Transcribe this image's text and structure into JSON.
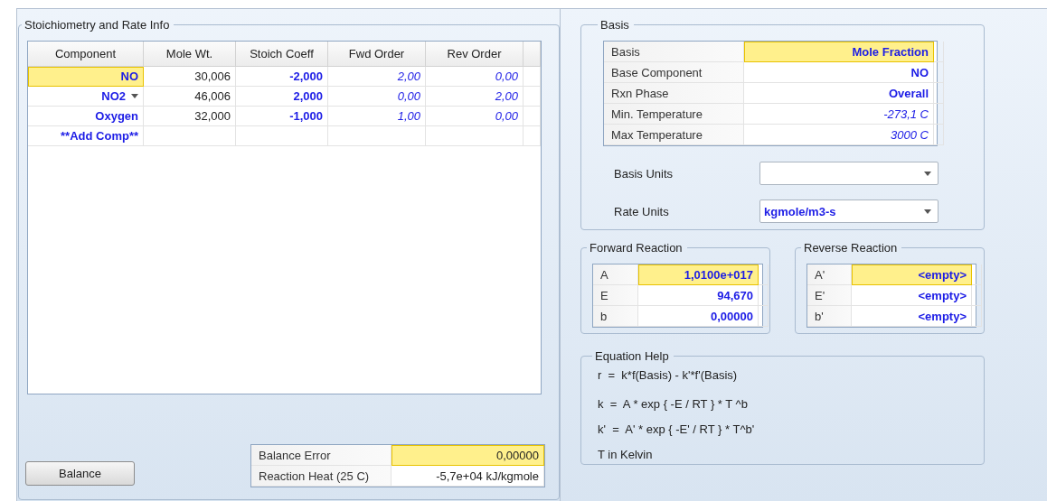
{
  "stoichiometry": {
    "title": "Stoichiometry and Rate Info",
    "columns": [
      "Component",
      "Mole Wt.",
      "Stoich Coeff",
      "Fwd Order",
      "Rev Order"
    ],
    "rows": [
      {
        "cells": [
          {
            "text": "NO",
            "kind": "specified",
            "selected": true
          },
          {
            "text": "30,006",
            "kind": "calculated",
            "selected": false
          },
          {
            "text": "-2,000",
            "kind": "specified",
            "selected": false
          },
          {
            "text": "2,00",
            "kind": "default",
            "selected": false
          },
          {
            "text": "0,00",
            "kind": "default",
            "selected": false
          }
        ]
      },
      {
        "cells": [
          {
            "text": "NO2",
            "kind": "specified",
            "selected": false,
            "dropdown": true
          },
          {
            "text": "46,006",
            "kind": "calculated",
            "selected": false
          },
          {
            "text": "2,000",
            "kind": "specified",
            "selected": false
          },
          {
            "text": "0,00",
            "kind": "default",
            "selected": false
          },
          {
            "text": "2,00",
            "kind": "default",
            "selected": false
          }
        ]
      },
      {
        "cells": [
          {
            "text": "Oxygen",
            "kind": "specified",
            "selected": false
          },
          {
            "text": "32,000",
            "kind": "calculated",
            "selected": false
          },
          {
            "text": "-1,000",
            "kind": "specified",
            "selected": false
          },
          {
            "text": "1,00",
            "kind": "default",
            "selected": false
          },
          {
            "text": "0,00",
            "kind": "default",
            "selected": false
          }
        ]
      },
      {
        "cells": [
          {
            "text": "**Add Comp**",
            "kind": "specified",
            "selected": false
          }
        ]
      }
    ]
  },
  "balance_button": "Balance",
  "balance": {
    "rows": [
      {
        "cells": [
          {
            "text": "Balance Error",
            "kind": "label"
          },
          {
            "text": "0,00000",
            "kind": "calculated",
            "selected": true
          }
        ]
      },
      {
        "cells": [
          {
            "text": "Reaction Heat (25 C)",
            "kind": "label"
          },
          {
            "text": "-5,7e+04 kJ/kgmole",
            "kind": "calculated",
            "selected": false
          }
        ]
      }
    ]
  },
  "basis": {
    "title": "Basis",
    "rows": [
      {
        "cells": [
          {
            "text": "Basis",
            "kind": "label"
          },
          {
            "text": "Mole Fraction",
            "kind": "specified",
            "selected": true
          }
        ]
      },
      {
        "cells": [
          {
            "text": "Base Component",
            "kind": "label"
          },
          {
            "text": "NO",
            "kind": "specified",
            "selected": false
          }
        ]
      },
      {
        "cells": [
          {
            "text": "Rxn Phase",
            "kind": "label"
          },
          {
            "text": "Overall",
            "kind": "specified",
            "selected": false
          }
        ]
      },
      {
        "cells": [
          {
            "text": "Min. Temperature",
            "kind": "label"
          },
          {
            "text": "-273,1 C",
            "kind": "default",
            "selected": false
          }
        ]
      },
      {
        "cells": [
          {
            "text": "Max Temperature",
            "kind": "label"
          },
          {
            "text": "3000 C",
            "kind": "default",
            "selected": false
          }
        ]
      }
    ],
    "fields": [
      {
        "label": "Basis Units"
      },
      {
        "label": "Rate Units",
        "value": "kgmole/m3-s"
      }
    ]
  },
  "forward_reaction": {
    "title": "Forward Reaction",
    "rows": [
      {
        "cells": [
          {
            "text": "A",
            "kind": "label"
          },
          {
            "text": "1,0100e+017",
            "kind": "specified",
            "selected": true
          }
        ]
      },
      {
        "cells": [
          {
            "text": "E",
            "kind": "label"
          },
          {
            "text": "94,670",
            "kind": "specified",
            "selected": false
          }
        ]
      },
      {
        "cells": [
          {
            "text": "b",
            "kind": "label"
          },
          {
            "text": "0,00000",
            "kind": "specified",
            "selected": false
          }
        ]
      }
    ]
  },
  "reverse_reaction": {
    "title": "Reverse Reaction",
    "rows": [
      {
        "cells": [
          {
            "text": "A'",
            "kind": "label"
          },
          {
            "text": "<empty>",
            "kind": "specified",
            "selected": true
          }
        ]
      },
      {
        "cells": [
          {
            "text": "E'",
            "kind": "label"
          },
          {
            "text": "<empty>",
            "kind": "specified",
            "selected": false
          }
        ]
      },
      {
        "cells": [
          {
            "text": "b'",
            "kind": "label"
          },
          {
            "text": "<empty>",
            "kind": "specified",
            "selected": false
          }
        ]
      }
    ]
  },
  "equation_help": {
    "title": "Equation Help",
    "lines": [
      "r  =  k*f(Basis) - k'*f'(Basis)",
      "k  =  A * exp { -E / RT } * T ^b",
      "k'  =  A' * exp { -E' / RT } * T^b'",
      "T in Kelvin"
    ]
  }
}
